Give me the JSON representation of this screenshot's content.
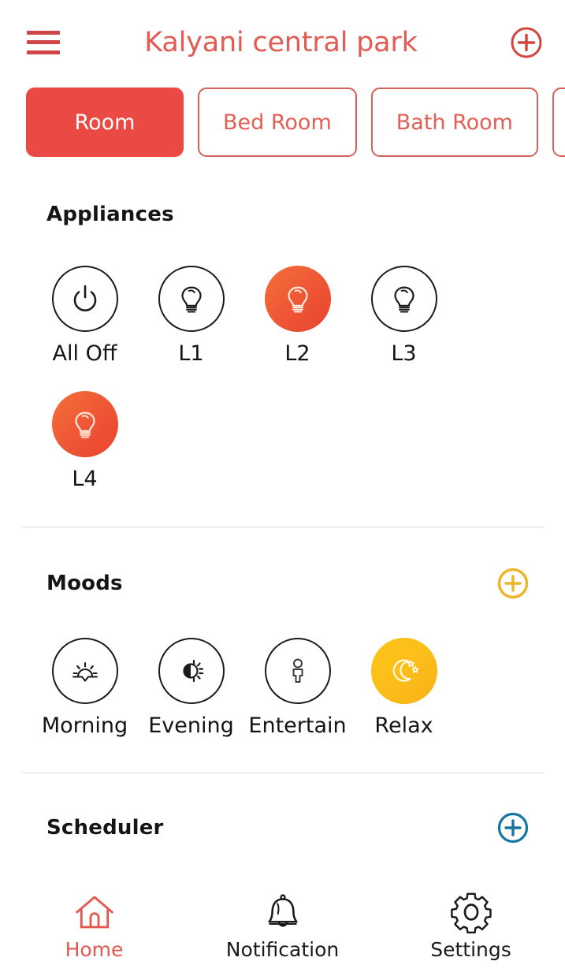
{
  "header": {
    "menu_icon": "hamburger-menu-icon",
    "title": "Kalyani central park",
    "add_icon": "plus-circle-icon",
    "accent_color": "#e35b52"
  },
  "tabs": {
    "items": [
      {
        "label": "Room",
        "active": true
      },
      {
        "label": "Bed Room",
        "active": false
      },
      {
        "label": "Bath Room",
        "active": false
      },
      {
        "label": "",
        "active": false,
        "partial": true
      }
    ],
    "active_bg": "#ea4a43",
    "inactive_border": "#d4615a"
  },
  "appliances": {
    "title": "Appliances",
    "items": [
      {
        "label": "All Off",
        "icon": "power-icon",
        "on": false
      },
      {
        "label": "L1",
        "icon": "bulb-icon",
        "on": false
      },
      {
        "label": "L2",
        "icon": "bulb-icon",
        "on": true
      },
      {
        "label": "L3",
        "icon": "bulb-icon",
        "on": false
      },
      {
        "label": "L4",
        "icon": "bulb-icon",
        "on": true
      }
    ],
    "on_color": "#ef5a36"
  },
  "moods": {
    "title": "Moods",
    "add_icon": "plus-circle-icon",
    "add_color": "#f0b429",
    "items": [
      {
        "label": "Morning",
        "icon": "sunrise-icon",
        "on": false
      },
      {
        "label": "Evening",
        "icon": "brightness-half-icon",
        "on": false
      },
      {
        "label": "Entertain",
        "icon": "person-icon",
        "on": false
      },
      {
        "label": "Relax",
        "icon": "moon-stars-icon",
        "on": true
      }
    ],
    "on_color": "#fbc417"
  },
  "scheduler": {
    "title": "Scheduler",
    "add_icon": "plus-circle-icon",
    "add_color": "#1476a0"
  },
  "bottom_nav": {
    "items": [
      {
        "label": "Home",
        "icon": "home-icon",
        "active": true
      },
      {
        "label": "Notification",
        "icon": "bell-icon",
        "active": false
      },
      {
        "label": "Settings",
        "icon": "gear-icon",
        "active": false
      }
    ],
    "active_color": "#e05a50"
  }
}
